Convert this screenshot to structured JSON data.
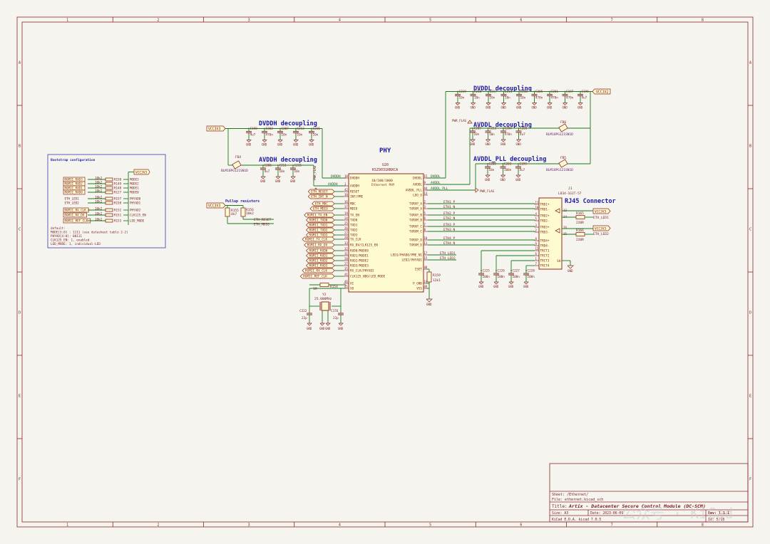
{
  "border": {
    "cols": [
      "1",
      "2",
      "3",
      "4",
      "5",
      "6",
      "7",
      "8"
    ],
    "rows": [
      "A",
      "B",
      "C",
      "D",
      "E",
      "F"
    ]
  },
  "sections": {
    "dvddh": "DVDDH decoupling",
    "avddh": "AVDDH decoupling",
    "dvddl": "DVDDL decoupling",
    "avddl": "AVDDL decoupling",
    "avddl_pll": "AVDDL_PLL decoupling",
    "phy": "PHY",
    "rj45": "RJ45 Connector",
    "pullup": "Pullup resistors",
    "bootstrap": "Bootstrap configuration"
  },
  "ic": {
    "ref": "U20",
    "part": "KSZ9031RNXCA",
    "desc1": "10/100/1000",
    "desc2": "Ethernet PHY",
    "left_pins": [
      {
        "num": "10",
        "name": "DVDDH"
      },
      {
        "num": "1",
        "name": "AVDDH"
      },
      {
        "num": "42",
        "name": "RESET"
      },
      {
        "num": "38",
        "name": "INT/PME"
      },
      {
        "num": "36",
        "name": "MDC"
      },
      {
        "num": "37",
        "name": "MDIO"
      },
      {
        "num": "19",
        "name": "TX_EN"
      },
      {
        "num": "24",
        "name": "TXD0"
      },
      {
        "num": "25",
        "name": "TXD1"
      },
      {
        "num": "26",
        "name": "TXD2"
      },
      {
        "num": "27",
        "name": "TXD3"
      },
      {
        "num": "20",
        "name": "TX_CLK"
      },
      {
        "num": "33",
        "name": "RX_DV/CLK125_EN"
      },
      {
        "num": "32",
        "name": "RXD0/MODE0"
      },
      {
        "num": "31",
        "name": "RXD1/MODE1"
      },
      {
        "num": "28",
        "name": "RXD2/MODE2"
      },
      {
        "num": "27",
        "name": "RXD3/MODE3"
      },
      {
        "num": "35",
        "name": "RX_CLK/PHYAD2"
      },
      {
        "num": "41",
        "name": "CLK125_NDO/LED_MODE"
      },
      {
        "num": "46",
        "name": "XI"
      },
      {
        "num": "45",
        "name": "XO"
      }
    ],
    "right_pins": [
      {
        "num": "15",
        "name": "DVDDL"
      },
      {
        "num": "9",
        "name": "AVDDL"
      },
      {
        "num": "44",
        "name": "AVDDL_PLL"
      },
      {
        "num": "13",
        "name": "LDO_O"
      },
      {
        "num": "2",
        "name": "TXRXP_A"
      },
      {
        "num": "3",
        "name": "TXRXM_A"
      },
      {
        "num": "5",
        "name": "TXRXP_B"
      },
      {
        "num": "6",
        "name": "TXRXM_B"
      },
      {
        "num": "7",
        "name": "TXRXP_C"
      },
      {
        "num": "8",
        "name": "TXRXM_C"
      },
      {
        "num": "10",
        "name": "TXRXP_D"
      },
      {
        "num": "11",
        "name": "TXRXM_D"
      },
      {
        "num": "17",
        "name": "LED1/PHAD0/PME_N1"
      },
      {
        "num": "15",
        "name": "LED2/PHYAD1"
      },
      {
        "num": "48",
        "name": "ISET"
      },
      {
        "num": "14",
        "name": "P_GND"
      },
      {
        "num": "49",
        "name": "VSS"
      }
    ]
  },
  "nets": {
    "vcc3v3": "VCC3V3",
    "vcc1v2": "VCC1V2",
    "gnd": "GND",
    "pwr_flag": "PWR_FLAG",
    "dvddh": "DVDDH",
    "avddh": "AVDDH",
    "dvddl": "DVDDL",
    "avddl": "AVDDL",
    "avddl_pll": "AVDDL_PLL",
    "eth_reset": "ETH_RESET",
    "eth_int_n": "ETH_INT_N",
    "eth_mdc": "ETH_MDC",
    "eth_mdio": "ETH_MDIO",
    "rgmii_tx_en": "RGMII_TX_EN",
    "rgmii_txd0": "RGMII_TXD0",
    "rgmii_txd1": "RGMII_TXD1",
    "rgmii_txd2": "RGMII_TXD2",
    "rgmii_txd3": "RGMII_TXD3",
    "rgmii_tx_clk": "RGMII_TX_CLK",
    "rgmii_rx_dv": "RGMII_RX_DV",
    "rgmii_rxd0": "RGMII_RXD0",
    "rgmii_rxd1": "RGMII_RXD1",
    "rgmii_rxd2": "RGMII_RXD2",
    "rgmii_rxd3": "RGMII_RXD3",
    "rgmii_rx_clk": "RGMII_RX_CLK",
    "rgmii_ref_clk": "RGMII_REF_CLK",
    "eth_led1": "ETH_LED1",
    "eth_led2": "ETH_LED2",
    "eth1_p": "ETH1_P",
    "eth1_n": "ETH1_N",
    "eth2_p": "ETH2_P",
    "eth2_n": "ETH2_N",
    "eth3_p": "ETH3_P",
    "eth3_n": "ETH3_N",
    "eth4_p": "ETH4_P",
    "eth4_n": "ETH4_N"
  },
  "caps": {
    "dvddh": [
      {
        "ref": "C198",
        "val": "4u7"
      },
      {
        "ref": "C202",
        "val": "470n"
      },
      {
        "ref": "C207",
        "val": "10n"
      },
      {
        "ref": "C212",
        "val": "10n"
      },
      {
        "ref": "C216",
        "val": "10n"
      }
    ],
    "avddh": [
      {
        "ref": "C206",
        "val": "4u7"
      },
      {
        "ref": "C211",
        "val": "10n"
      },
      {
        "ref": "C215",
        "val": "10n"
      }
    ],
    "dvddl": [
      {
        "ref": "C219",
        "val": "10n"
      },
      {
        "ref": "C218",
        "val": "10n"
      },
      {
        "ref": "C217",
        "val": "10n"
      },
      {
        "ref": "C214",
        "val": "10n"
      },
      {
        "ref": "C210",
        "val": "10n"
      },
      {
        "ref": "C205",
        "val": "470n"
      },
      {
        "ref": "C201",
        "val": "470n"
      },
      {
        "ref": "C197",
        "val": "470n"
      },
      {
        "ref": "C196",
        "val": "4u7"
      }
    ],
    "avddl": [
      {
        "ref": "C209",
        "val": "10n"
      },
      {
        "ref": "C213",
        "val": "10n"
      },
      {
        "ref": "C204",
        "val": "470n"
      },
      {
        "ref": "C200",
        "val": "4u7"
      }
    ],
    "avddl_pll": [
      {
        "ref": "C208",
        "val": "10n"
      },
      {
        "ref": "C203",
        "val": "100n"
      },
      {
        "ref": "C199",
        "val": "4u7"
      }
    ],
    "rj45_ct": [
      {
        "ref": "C225",
        "val": "100n"
      },
      {
        "ref": "C226",
        "val": "100n"
      },
      {
        "ref": "C227",
        "val": "100n"
      },
      {
        "ref": "C228",
        "val": "100n"
      }
    ]
  },
  "ferrites": {
    "fb4": {
      "ref": "FB4",
      "part": "BLM18PG121SN1D"
    },
    "fb6": {
      "ref": "FB6",
      "part": "BLM18PG121SN1D"
    },
    "fb5": {
      "ref": "FB5",
      "part": "BLM18PG121SN1D"
    }
  },
  "pullups": [
    {
      "ref": "R155",
      "val": "4k7"
    },
    {
      "ref": "R156",
      "val": "10k2"
    }
  ],
  "bootstrap": {
    "rows": [
      {
        "net": "RGMII_RXD3",
        "val": "10k2",
        "ref": "R150",
        "func": "MODE3"
      },
      {
        "net": "RGMII_RXD2",
        "val": "10k2",
        "ref": "R149",
        "func": "MODE2"
      },
      {
        "net": "RGMII_RXD1",
        "val": "10k2",
        "ref": "R148",
        "func": "MODE1"
      },
      {
        "net": "RGMII_RXD0",
        "val": "10k2",
        "ref": "R127",
        "func": "MODE0"
      },
      {
        "net": "ETH_LED1",
        "val": "10k2",
        "ref": "R157",
        "func": "PHYAD0"
      },
      {
        "net": "ETH_LED2",
        "val": "10k2",
        "ref": "R158",
        "func": "PHYAD1"
      },
      {
        "net": "RGMII_RX_CLK",
        "val": "10k2",
        "ref": "R152",
        "func": "PHYAD2"
      },
      {
        "net": "RGMII_RX_DV",
        "val": "10k2",
        "ref": "R151",
        "func": "CLK125_EN"
      },
      {
        "net": "RGMII_REF_CLK",
        "val": "10k2",
        "ref": "R153",
        "func": "LED_MODE"
      }
    ],
    "notes": [
      "default:",
      "MODE[3:0] : 1111 (see datasheet table 2-2)",
      "PHYAD[4:0]: 00111",
      "CLK125_EN: 1, enabled",
      "LED_MODE: 1, individual-LED"
    ]
  },
  "crystal": {
    "ref": "Y2",
    "freq": "25.000MHz",
    "r_ref": "R154",
    "r_val": "1M",
    "c1_ref": "C222",
    "c1_val": "22p",
    "c2_ref": "C176",
    "c2_val": "22p"
  },
  "iset": {
    "ref": "R159",
    "val": "12k1"
  },
  "rj45": {
    "ref": "J1",
    "part": "L834-1G1T-57",
    "pins_left": [
      {
        "num": "11",
        "name": "TRD1+"
      },
      {
        "num": "10",
        "name": "TRD1-"
      },
      {
        "num": "4",
        "name": "TRD2+"
      },
      {
        "num": "5",
        "name": "TRD2-"
      },
      {
        "num": "3",
        "name": "TRD3+"
      },
      {
        "num": "2",
        "name": "TRD3-"
      },
      {
        "num": "8",
        "name": "TRD4+"
      },
      {
        "num": "9",
        "name": "TRD4-"
      },
      {
        "num": "12",
        "name": "TRCT1"
      },
      {
        "num": "6",
        "name": "TRCT2"
      },
      {
        "num": "1",
        "name": "TRCT3"
      },
      {
        "num": "7",
        "name": "TRCT4"
      }
    ],
    "led_pins": [
      "13",
      "14",
      "16",
      "15"
    ],
    "sh": "SH",
    "r_led1": {
      "ref": "R165",
      "val": "220R"
    },
    "r_led2": {
      "ref": "R166",
      "val": "220R"
    }
  },
  "title_block": {
    "sheet": "Sheet: /Ethernet/",
    "file": "File: ethernet.kicad_sch",
    "title_lbl": "Title:",
    "title": "Artix - Datacenter Secure Control Module (DC-SCM)",
    "size": "Size: A3",
    "date": "Date: 2023-06-09",
    "rev": "Rev: 1.1.1",
    "kicad": "KiCad E.D.A.  kicad 7.0.5",
    "id": "Id: 5/18"
  },
  "watermark": "公众号 · KiCad"
}
